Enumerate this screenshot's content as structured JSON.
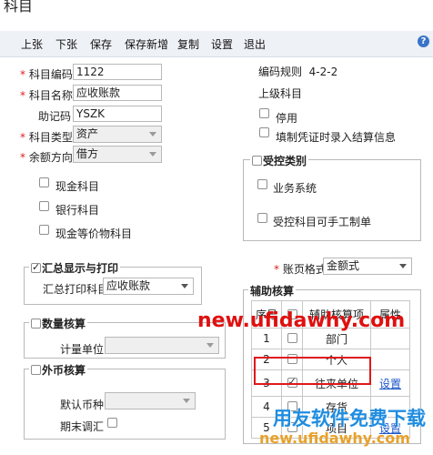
{
  "window": {
    "title": "科目"
  },
  "toolbar": {
    "buttons": [
      "上张",
      "下张",
      "保存",
      "保存新增",
      "复制",
      "设置",
      "退出"
    ],
    "help": "?"
  },
  "form": {
    "code": {
      "label": "科目编码",
      "value": "1122"
    },
    "name": {
      "label": "科目名称",
      "value": "应收账款"
    },
    "mnemonic": {
      "label": "助记码",
      "value": "YSZK"
    },
    "type": {
      "label": "科目类型",
      "value": "资产"
    },
    "direction": {
      "label": "余额方向",
      "value": "借方"
    },
    "cash": {
      "label": "现金科目",
      "checked": false
    },
    "bank": {
      "label": "银行科目",
      "checked": false
    },
    "cash_eq": {
      "label": "现金等价物科目",
      "checked": false
    }
  },
  "right": {
    "coding_rule_label": "编码规则",
    "coding_rule_value": "4-2-2",
    "parent_label": "上级科目",
    "disable": {
      "label": "停用",
      "checked": false
    },
    "settlement": {
      "label": "填制凭证时录入结算信息",
      "checked": false
    },
    "controlled": {
      "title": "受控类别",
      "title_checked": false,
      "business": {
        "label": "业务系统",
        "checked": false
      },
      "manual": {
        "label": "受控科目可手工制单",
        "checked": false
      }
    },
    "ledger_format": {
      "label": "账页格式",
      "value": "金额式"
    }
  },
  "summary": {
    "title": "汇总显示与打印",
    "checked": true,
    "print_label": "汇总打印科目",
    "print_value": "应收账款"
  },
  "quantity": {
    "title": "数量核算",
    "checked": false,
    "unit_label": "计量单位",
    "unit_value": ""
  },
  "foreign": {
    "title": "外币核算",
    "checked": false,
    "currency_label": "默认币种",
    "currency_value": "",
    "period_end_label": "期末调汇",
    "period_end_checked": false
  },
  "aux": {
    "title": "辅助核算",
    "headers": [
      "序号",
      "",
      "辅助核算项",
      "属性"
    ],
    "rows": [
      {
        "no": "1",
        "checked": false,
        "item": "部门",
        "attr": ""
      },
      {
        "no": "2",
        "checked": false,
        "item": "个人",
        "attr": ""
      },
      {
        "no": "3",
        "checked": true,
        "item": "往来单位",
        "attr": "设置"
      },
      {
        "no": "4",
        "checked": false,
        "item": "存货",
        "attr": ""
      },
      {
        "no": "5",
        "checked": false,
        "item": "项目",
        "attr": "设置"
      }
    ]
  },
  "watermarks": {
    "top": "new.ufidawhy.com",
    "brand": "用友软件免费下载",
    "bottom": "new.ufidawhy.com"
  }
}
